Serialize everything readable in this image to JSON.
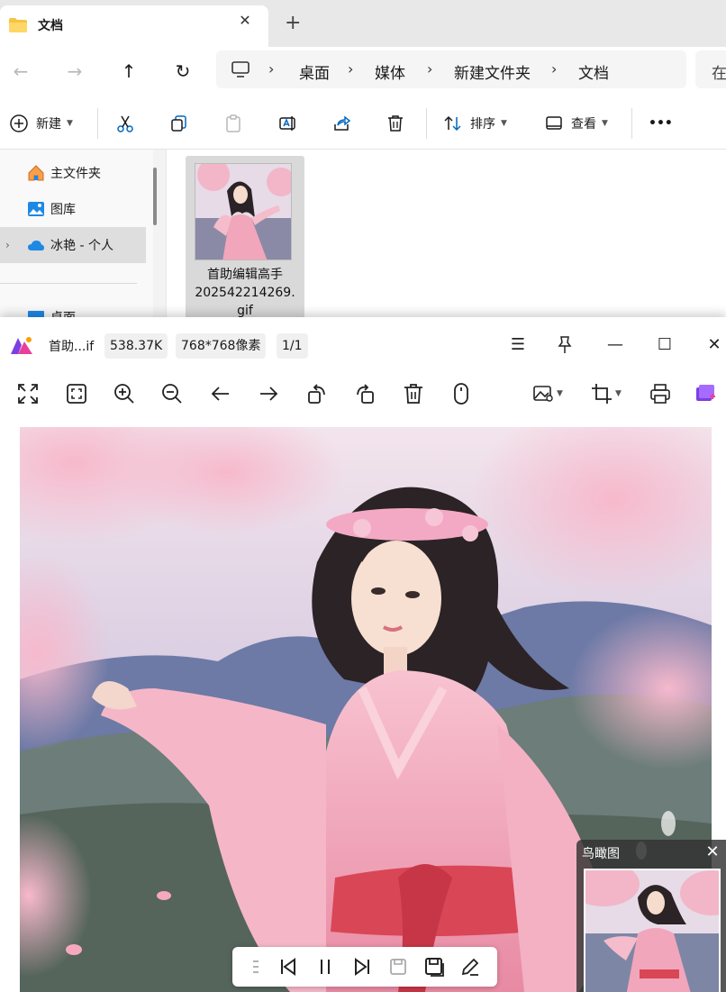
{
  "explorer": {
    "tab_title": "文档",
    "tab_close": "✕",
    "new_tab": "+",
    "nav": {
      "back": "←",
      "forward": "→",
      "up": "↑",
      "refresh": "↻"
    },
    "breadcrumb": [
      "桌面",
      "媒体",
      "新建文件夹",
      "文档"
    ],
    "separator": "›",
    "search_placeholder": "在",
    "commands": {
      "new_label": "新建",
      "sort_label": "排序",
      "view_label": "查看",
      "more_label": "•••"
    },
    "sidebar": {
      "items": [
        {
          "label": "主文件夹"
        },
        {
          "label": "图库"
        },
        {
          "label": "冰艳 - 个人",
          "chevron": "›"
        },
        {
          "label": "桌面"
        }
      ]
    },
    "file": {
      "name_line1": "首助编辑高手",
      "name_line2": "202542214269.",
      "name_line3": "gif"
    }
  },
  "viewer": {
    "file_name": "首助...if",
    "file_size": "538.37K",
    "dimensions": "768*768像素",
    "page_index": "1/1",
    "window": {
      "menu": "☰",
      "minimize": "—",
      "maximize": "☐",
      "close": "✕"
    },
    "birdview_title": "鸟瞰图",
    "birdview_close": "✕"
  },
  "colors": {
    "accent_blue": "#0067c0",
    "folder_yellow": "#f4c542",
    "onedrive_blue": "#1e88e5",
    "logo_pink": "#e8409a",
    "logo_purple": "#7b3fe4",
    "cherry_pink": "#f2a3bd"
  }
}
